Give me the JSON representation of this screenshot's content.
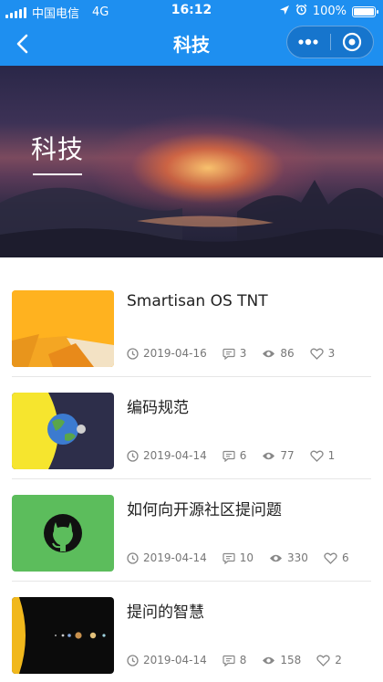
{
  "status_bar": {
    "carrier": "中国电信",
    "network": "4G",
    "time": "16:12",
    "battery": "100%",
    "battery_level": 1.0
  },
  "nav": {
    "title": "科技",
    "back_icon": "chevron-left-icon",
    "more_icon": "more-dots-icon",
    "close_icon": "target-circle-icon"
  },
  "hero": {
    "title": "科技"
  },
  "articles": [
    {
      "title": "Smartisan OS TNT",
      "date": "2019-04-16",
      "comments": "3",
      "views": "86",
      "likes": "3",
      "thumb": "orange-geometric"
    },
    {
      "title": "编码规范",
      "date": "2019-04-14",
      "comments": "6",
      "views": "77",
      "likes": "1",
      "thumb": "earth-moon"
    },
    {
      "title": "如何向开源社区提问题",
      "date": "2019-04-14",
      "comments": "10",
      "views": "330",
      "likes": "6",
      "thumb": "github-logo"
    },
    {
      "title": "提问的智慧",
      "date": "2019-04-14",
      "comments": "8",
      "views": "158",
      "likes": "2",
      "thumb": "solar-system"
    }
  ],
  "colors": {
    "nav_blue": "#1e8ff0",
    "meta_gray": "#777777"
  }
}
